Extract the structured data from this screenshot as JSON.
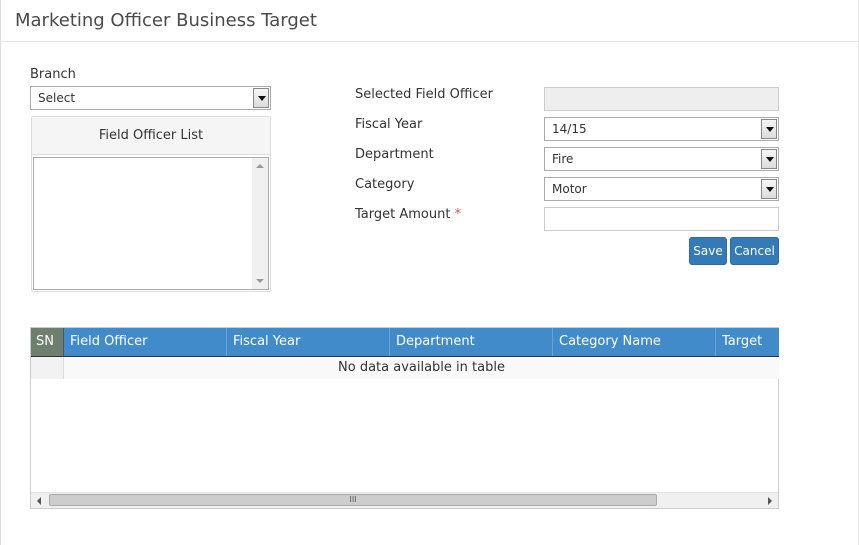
{
  "page": {
    "title": "Marketing Officer Business Target"
  },
  "branch": {
    "label": "Branch",
    "value": "Select"
  },
  "field_officer_list": {
    "header": "Field Officer List"
  },
  "form": {
    "selected_field_officer": {
      "label": "Selected Field Officer",
      "value": ""
    },
    "fiscal_year": {
      "label": "Fiscal Year",
      "value": "14/15"
    },
    "department": {
      "label": "Department",
      "value": "Fire"
    },
    "category": {
      "label": "Category",
      "value": "Motor"
    },
    "target_amount": {
      "label": "Target Amount",
      "required_marker": "*",
      "value": ""
    },
    "save_label": "Save",
    "cancel_label": "Cancel"
  },
  "table": {
    "columns": [
      "SN",
      "Field Officer",
      "Fiscal Year",
      "Department",
      "Category Name",
      "Target"
    ],
    "empty_message": "No data available in table",
    "scroll_grip": "III"
  },
  "colors": {
    "header_blue": "#428bca",
    "button_blue": "#337ab7",
    "required_red": "#d9534f"
  }
}
